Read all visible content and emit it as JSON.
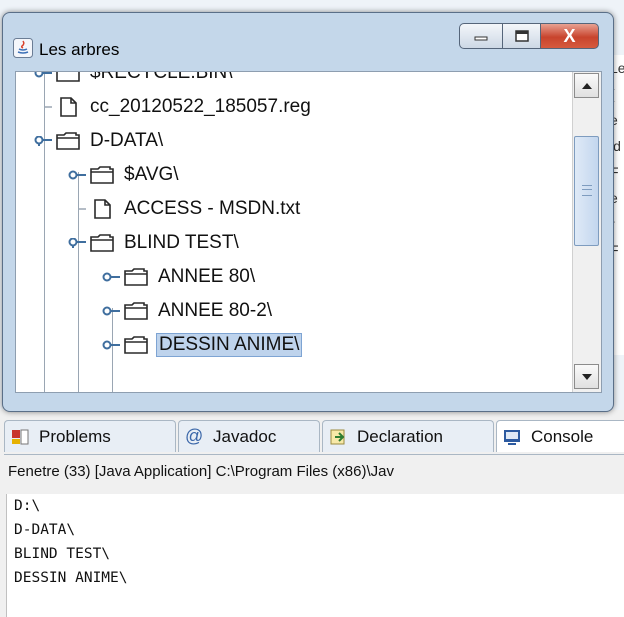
{
  "window": {
    "title": "Les arbres",
    "close_label": "X"
  },
  "tree": {
    "nodes": [
      {
        "label": "$RECYCLE.BIN\\",
        "type": "folder",
        "toggle": "collapsed"
      },
      {
        "label": "cc_20120522_185057.reg",
        "type": "file",
        "toggle": "none"
      },
      {
        "label": "D-DATA\\",
        "type": "folder",
        "toggle": "expanded"
      },
      {
        "label": "$AVG\\",
        "type": "folder",
        "toggle": "collapsed"
      },
      {
        "label": "ACCESS - MSDN.txt",
        "type": "file",
        "toggle": "none"
      },
      {
        "label": "BLIND TEST\\",
        "type": "folder",
        "toggle": "expanded"
      },
      {
        "label": "ANNEE 80\\",
        "type": "folder",
        "toggle": "collapsed"
      },
      {
        "label": "ANNEE 80-2\\",
        "type": "folder",
        "toggle": "collapsed"
      },
      {
        "label": "DESSIN ANIME\\",
        "type": "folder",
        "toggle": "collapsed",
        "selected": true
      }
    ]
  },
  "ide": {
    "tabs": [
      {
        "label": "Problems",
        "icon": "problems-icon"
      },
      {
        "label": "Javadoc",
        "icon": "at-icon"
      },
      {
        "label": "Declaration",
        "icon": "declaration-icon"
      },
      {
        "label": "Console",
        "icon": "console-icon",
        "active": true
      }
    ],
    "run_line": "Fenetre (33) [Java Application] C:\\Program Files (x86)\\Jav",
    "console_lines": [
      "D:\\",
      "D-DATA\\",
      "BLIND TEST\\",
      "DESSIN ANIME\\"
    ],
    "side_text": [
      "Le",
      "(",
      "e",
      "ld",
      "F",
      "e",
      "r",
      "F"
    ]
  },
  "colors": {
    "selection": "#bed3ec",
    "window_frame": "#c4d7ea",
    "close": "#c8442d"
  }
}
